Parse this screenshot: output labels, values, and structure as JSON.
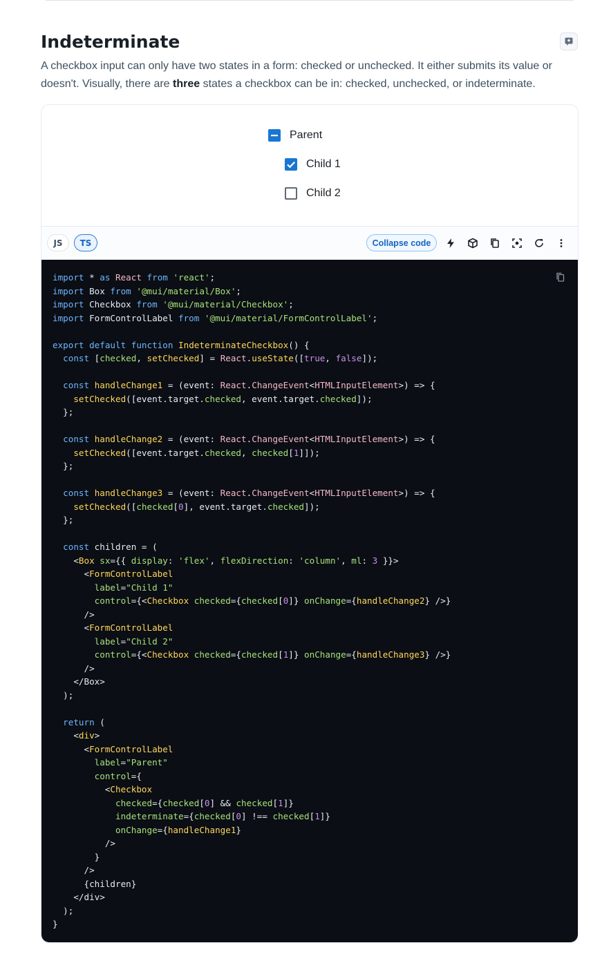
{
  "section": {
    "title": "Indeterminate",
    "description_parts": [
      "A checkbox input can only have two states in a form: checked or unchecked. It either submits its value or doesn't. Visually, there are ",
      "three",
      " states a checkbox can be in: checked, unchecked, or indeterminate."
    ]
  },
  "demo": {
    "checkboxes": [
      {
        "label": "Parent",
        "state": "indeterminate"
      },
      {
        "label": "Child 1",
        "state": "checked"
      },
      {
        "label": "Child 2",
        "state": "unchecked"
      }
    ],
    "colors": {
      "accent": "#1976d2",
      "code_bg": "#0b0e14"
    }
  },
  "toolbar": {
    "lang_js": "JS",
    "lang_ts": "TS",
    "selected_lang": "TS",
    "collapse_label": "Collapse code",
    "icons": [
      "bolt-icon",
      "cube-icon",
      "copy-icon",
      "focus-icon",
      "reset-icon",
      "more-icon"
    ]
  },
  "code": {
    "language": "tsx",
    "lines": [
      "import * as React from 'react';",
      "import Box from '@mui/material/Box';",
      "import Checkbox from '@mui/material/Checkbox';",
      "import FormControlLabel from '@mui/material/FormControlLabel';",
      "",
      "export default function IndeterminateCheckbox() {",
      "  const [checked, setChecked] = React.useState([true, false]);",
      "",
      "  const handleChange1 = (event: React.ChangeEvent<HTMLInputElement>) => {",
      "    setChecked([event.target.checked, event.target.checked]);",
      "  };",
      "",
      "  const handleChange2 = (event: React.ChangeEvent<HTMLInputElement>) => {",
      "    setChecked([event.target.checked, checked[1]]);",
      "  };",
      "",
      "  const handleChange3 = (event: React.ChangeEvent<HTMLInputElement>) => {",
      "    setChecked([checked[0], event.target.checked]);",
      "  };",
      "",
      "  const children = (",
      "    <Box sx={{ display: 'flex', flexDirection: 'column', ml: 3 }}>",
      "      <FormControlLabel",
      "        label=\"Child 1\"",
      "        control={<Checkbox checked={checked[0]} onChange={handleChange2} />}",
      "      />",
      "      <FormControlLabel",
      "        label=\"Child 2\"",
      "        control={<Checkbox checked={checked[1]} onChange={handleChange3} />}",
      "      />",
      "    </Box>",
      "  );",
      "",
      "  return (",
      "    <div>",
      "      <FormControlLabel",
      "        label=\"Parent\"",
      "        control={",
      "          <Checkbox",
      "            checked={checked[0] && checked[1]}",
      "            indeterminate={checked[0] !== checked[1]}",
      "            onChange={handleChange1}",
      "          />",
      "        }",
      "      />",
      "      {children}",
      "    </div>",
      "  );",
      "}"
    ]
  }
}
